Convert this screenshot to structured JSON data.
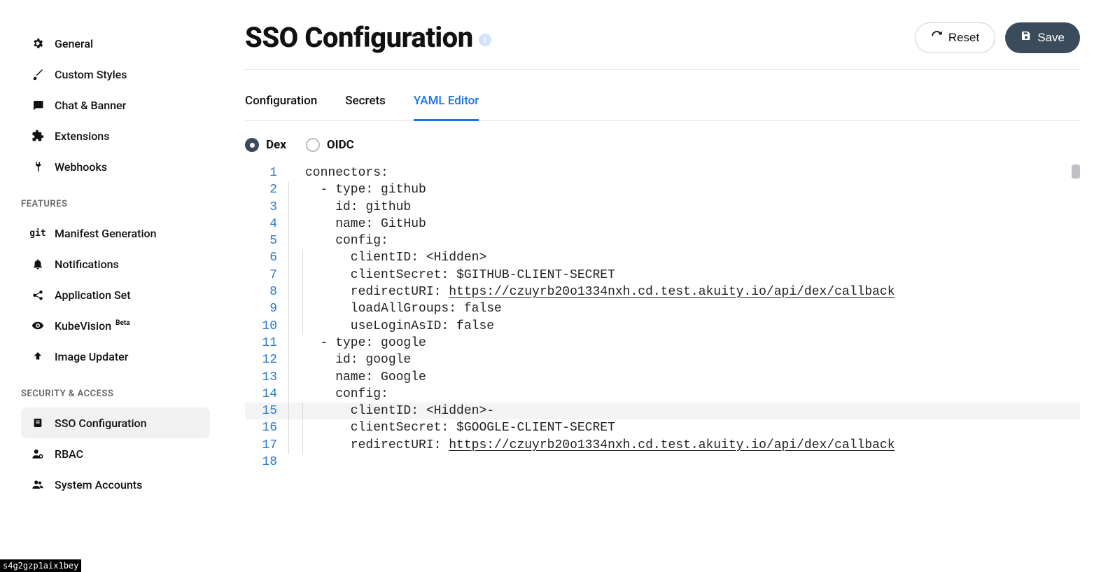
{
  "sidebar": {
    "items_top": [
      {
        "label": "General"
      },
      {
        "label": "Custom Styles"
      },
      {
        "label": "Chat & Banner"
      },
      {
        "label": "Extensions"
      },
      {
        "label": "Webhooks"
      }
    ],
    "features_title": "FEATURES",
    "items_features": [
      {
        "label": "Manifest Generation"
      },
      {
        "label": "Notifications"
      },
      {
        "label": "Application Set"
      },
      {
        "label": "KubeVision",
        "badge": "Beta"
      },
      {
        "label": "Image Updater"
      }
    ],
    "security_title": "SECURITY & ACCESS",
    "items_security": [
      {
        "label": "SSO Configuration"
      },
      {
        "label": "RBAC"
      },
      {
        "label": "System Accounts"
      }
    ]
  },
  "header": {
    "title": "SSO Configuration",
    "reset": "Reset",
    "save": "Save"
  },
  "tabs": {
    "configuration": "Configuration",
    "secrets": "Secrets",
    "yaml": "YAML Editor"
  },
  "radios": {
    "dex": "Dex",
    "oidc": "OIDC"
  },
  "editor": {
    "lines": [
      {
        "n": 1,
        "indent": 0,
        "guides": 0,
        "text": "connectors:"
      },
      {
        "n": 2,
        "indent": 1,
        "guides": 1,
        "text": "- type: github"
      },
      {
        "n": 3,
        "indent": 2,
        "guides": 1,
        "text": "id: github"
      },
      {
        "n": 4,
        "indent": 2,
        "guides": 1,
        "text": "name: GitHub"
      },
      {
        "n": 5,
        "indent": 2,
        "guides": 1,
        "text": "config:"
      },
      {
        "n": 6,
        "indent": 3,
        "guides": 2,
        "text": "clientID: <Hidden>"
      },
      {
        "n": 7,
        "indent": 3,
        "guides": 2,
        "text": "clientSecret: $GITHUB-CLIENT-SECRET"
      },
      {
        "n": 8,
        "indent": 3,
        "guides": 2,
        "text": "redirectURI: ",
        "url": "https://czuyrb20o1334nxh.cd.test.akuity.io/api/dex/callback"
      },
      {
        "n": 9,
        "indent": 3,
        "guides": 2,
        "text": "loadAllGroups: false"
      },
      {
        "n": 10,
        "indent": 3,
        "guides": 2,
        "text": "useLoginAsID: false"
      },
      {
        "n": 11,
        "indent": 1,
        "guides": 1,
        "text": "- type: google"
      },
      {
        "n": 12,
        "indent": 2,
        "guides": 1,
        "text": "id: google"
      },
      {
        "n": 13,
        "indent": 2,
        "guides": 1,
        "text": "name: Google"
      },
      {
        "n": 14,
        "indent": 2,
        "guides": 1,
        "text": "config:"
      },
      {
        "n": 15,
        "indent": 3,
        "guides": 2,
        "text": "clientID: <Hidden>-",
        "highlight": true
      },
      {
        "n": 16,
        "indent": 3,
        "guides": 2,
        "text": "clientSecret: $GOOGLE-CLIENT-SECRET"
      },
      {
        "n": 17,
        "indent": 3,
        "guides": 2,
        "text": "redirectURI: ",
        "url": "https://czuyrb20o1334nxh.cd.test.akuity.io/api/dex/callback"
      },
      {
        "n": 18,
        "indent": 0,
        "guides": 0,
        "text": ""
      }
    ]
  },
  "footer_token": "s4g2gzp1aix1bey"
}
